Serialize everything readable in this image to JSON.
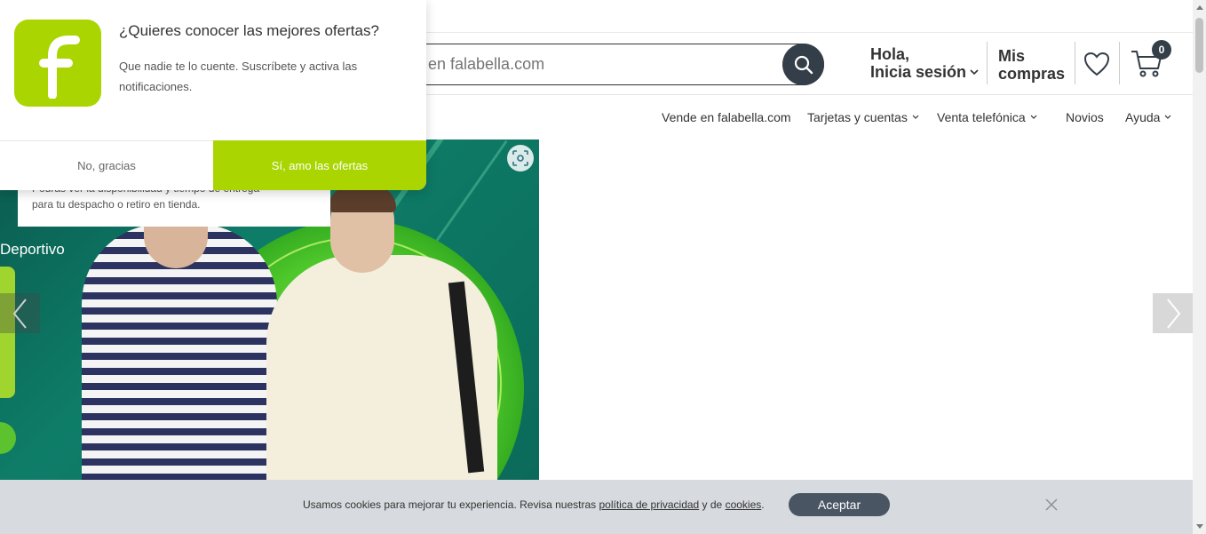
{
  "header": {
    "search_placeholder": "r en falabella.com",
    "greeting": "Hola,",
    "login_label": "Inicia sesión",
    "my_purchases": "Mis compras",
    "cart_count": "0"
  },
  "nav": {
    "items": [
      {
        "label": "Vende en falabella.com"
      },
      {
        "label": "Tarjetas y cuentas"
      },
      {
        "label": "Venta telefónica"
      },
      {
        "label": "Novios"
      },
      {
        "label": "Ayuda"
      }
    ]
  },
  "banner": {
    "side_text": "Deportivo",
    "tooltip_line1": "Podrás ver la disponibilidad y tiempo de entrega",
    "tooltip_line2": "para tu despacho o retiro en tienda."
  },
  "notification": {
    "title": "¿Quieres conocer las mejores ofertas?",
    "body": "Que nadie te lo cuente. Suscríbete y activa las notificaciones.",
    "decline": "No, gracias",
    "accept": "Sí, amo las ofertas",
    "brand_color": "#aad500"
  },
  "cookies": {
    "text_before": "Usamos cookies para mejorar tu experiencia. Revisa nuestras ",
    "privacy_link": "política de privacidad",
    "text_middle": " y de ",
    "cookies_link": "cookies",
    "text_after": ".",
    "accept": "Aceptar"
  },
  "colors": {
    "primary_dark": "#343e48",
    "accent_green": "#aad500",
    "cookie_bg": "#d7dade"
  }
}
